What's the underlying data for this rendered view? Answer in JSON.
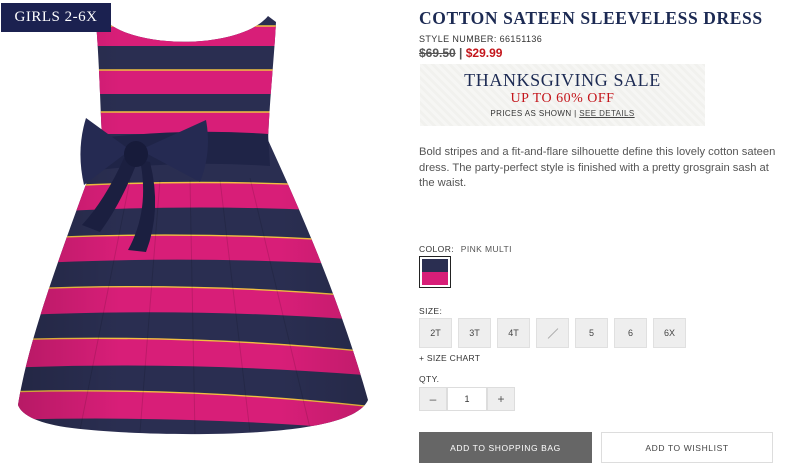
{
  "category_badge": "GIRLS 2-6X",
  "product": {
    "title": "COTTON SATEEN SLEEVELESS DRESS",
    "style_number_label": "STYLE NUMBER:",
    "style_number": "66151136",
    "original_price": "$69.50",
    "price_separator": "|",
    "sale_price": "$29.99",
    "description": "Bold stripes and a fit-and-flare silhouette define this lovely cotton sateen dress. The party-perfect style is finished with a pretty grosgrain sash at the waist."
  },
  "sale_banner": {
    "heading": "THANKSGIVING SALE",
    "subheading": "UP TO 60% OFF",
    "note": "PRICES AS SHOWN |",
    "link": "SEE DETAILS"
  },
  "color": {
    "label": "COLOR:",
    "value": "PINK MULTI",
    "swatch_colors": [
      "#2a2e51",
      "#d81e78"
    ]
  },
  "size": {
    "label": "SIZE:",
    "options": [
      "2T",
      "3T",
      "4T",
      "",
      "5",
      "6",
      "6X"
    ],
    "unavailable_index": 3,
    "size_chart_link": "+ SIZE CHART"
  },
  "quantity": {
    "label": "QTY.",
    "value": "1",
    "minus": "–",
    "plus": "+"
  },
  "actions": {
    "add_to_bag": "ADD TO SHOPPING BAG",
    "add_to_wishlist": "ADD TO WISHLIST"
  },
  "colors": {
    "navy": "#1c2a53",
    "sale_red": "#c4161c",
    "stripe_pink": "#d81e78",
    "stripe_navy": "#2a2e51",
    "stripe_gold": "#f0c040"
  }
}
